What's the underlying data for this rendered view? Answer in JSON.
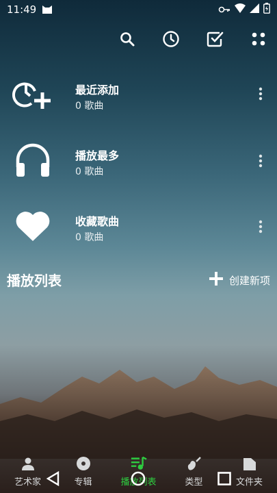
{
  "status_bar": {
    "time": "11:49"
  },
  "toolbar": {
    "icons": [
      "search-icon",
      "history-icon",
      "select-icon",
      "more-grid-icon"
    ]
  },
  "library": {
    "items": [
      {
        "title": "最近添加",
        "subtitle": "0 歌曲",
        "icon": "recent-add-icon"
      },
      {
        "title": "播放最多",
        "subtitle": "0 歌曲",
        "icon": "headphones-icon"
      },
      {
        "title": "收藏歌曲",
        "subtitle": "0 歌曲",
        "icon": "heart-icon"
      }
    ]
  },
  "playlists": {
    "heading": "播放列表",
    "create_label": "创建新项"
  },
  "bottom_nav": {
    "tabs": [
      {
        "label": "艺术家",
        "icon": "person-icon"
      },
      {
        "label": "专辑",
        "icon": "album-icon"
      },
      {
        "label": "播放列表",
        "icon": "playlist-icon",
        "active": true
      },
      {
        "label": "类型",
        "icon": "guitar-icon"
      },
      {
        "label": "文件夹",
        "icon": "folder-icon"
      }
    ],
    "active_color": "#2ecc40"
  }
}
